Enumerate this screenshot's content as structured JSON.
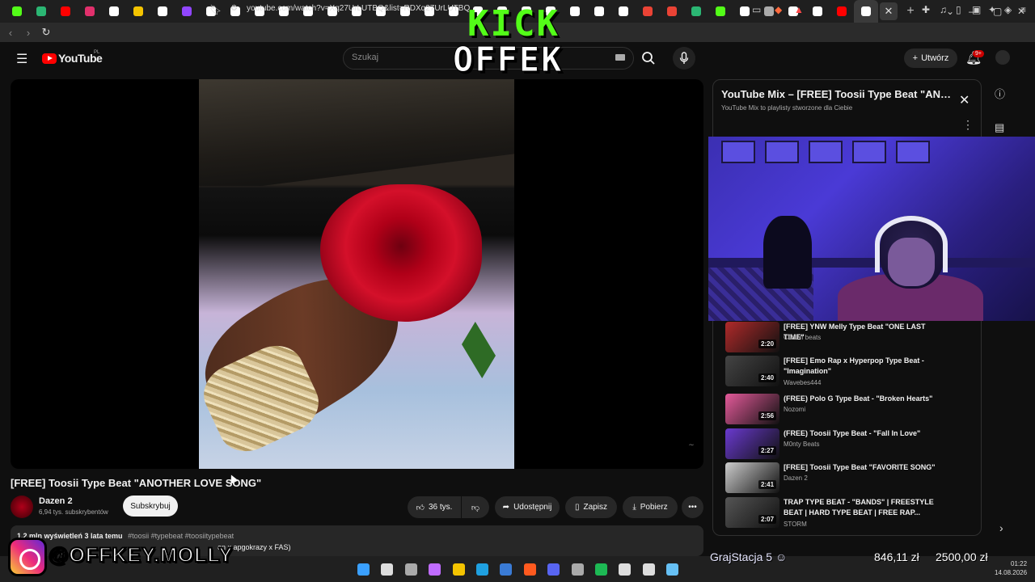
{
  "browser": {
    "url": "youtube.com/watch?v=Xq27UrLUTBQ&list=RDXq27UrLUTBQ",
    "tab_close": "✕",
    "new_tab": "+",
    "tab_icon_colors": [
      "#53fc18",
      "#2bb673",
      "#ff0000",
      "#e1306c",
      "#ffffff",
      "#f4c400",
      "#ffffff",
      "#9146ff",
      "#ffffff",
      "#ffffff",
      "#ffffff",
      "#ffffff",
      "#ffffff",
      "#ffffff",
      "#ffffff",
      "#ffffff",
      "#ffffff",
      "#ffffff",
      "#ffffff",
      "#ffffff",
      "#ffffff",
      "#ffffff",
      "#ffffff",
      "#ffffff",
      "#ffffff",
      "#ffffff",
      "#ea4335",
      "#ea4335",
      "#2bb673",
      "#53fc18",
      "#ffffff",
      "#aaaaaa",
      "#ffffff",
      "#ffffff",
      "#ff0000",
      "#ffffff"
    ]
  },
  "youtube": {
    "logo_text": "YouTube",
    "logo_region": "PL",
    "search_placeholder": "Szukaj",
    "create_label": "Utwórz",
    "notification_count": "9+"
  },
  "overlay": {
    "kick_text": "KICK",
    "offek_text": "OFFEK",
    "instagram_handle": "@OFFKEY.MOLLY",
    "promo_name": "GrajStacja 5",
    "amount_1": "846,11 zł",
    "amount_2": "2500,00 zł"
  },
  "video": {
    "title": "[FREE] Toosii Type Beat \"ANOTHER LOVE SONG\"",
    "channel": "Dazen 2",
    "subscribers": "6,94 tys. subskrybentów",
    "subscribe_label": "Subskrybuj",
    "likes": "36 tys.",
    "share_label": "Udostępnij",
    "save_label": "Zapisz",
    "download_label": "Pobierz",
    "desc_line1_stats": "1,2 mln wyświetleń  3 lata temu",
    "desc_line1_tags": "#toosii #typebeat #toosiitypebeat",
    "desc_line2": "en x apgokrazy x FAS)"
  },
  "playlist": {
    "title": "YouTube Mix – [FREE] Toosii Type Beat \"ANOTHER LOVE SONG\"",
    "subtitle": "YouTube Mix to playlisty stworzone dla Ciebie",
    "items": [
      {
        "title": "[FREE] YNW Melly Type Beat \"ONE LAST TIME\"",
        "channel": "COLNI beats",
        "duration": "2:20",
        "color": "#b02a2a"
      },
      {
        "title": "[FREE] Emo Rap x Hyperpop Type Beat - \"Imagination\"",
        "channel": "Wavebes444",
        "duration": "2:40",
        "color": "#444444"
      },
      {
        "title": "(FREE) Polo G Type Beat - \"Broken Hearts\"",
        "channel": "Nozomi",
        "duration": "2:56",
        "color": "#e45a9a"
      },
      {
        "title": "(FREE) Toosii Type Beat - \"Fall In Love\"",
        "channel": "M0nty Beats",
        "duration": "2:27",
        "color": "#6a3ad0"
      },
      {
        "title": "[FREE] Toosii Type Beat \"FAVORITE SONG\"",
        "channel": "Dazen 2",
        "duration": "2:41",
        "color": "#cccccc"
      },
      {
        "title": "TRAP TYPE BEAT - \"BANDS\" | FREESTYLE BEAT | HARD TYPE BEAT | FREE RAP...",
        "channel": "STORM",
        "duration": "2:07",
        "color": "#555555"
      }
    ]
  },
  "taskbar": {
    "time": "01:22",
    "date": "14.08.2026"
  }
}
